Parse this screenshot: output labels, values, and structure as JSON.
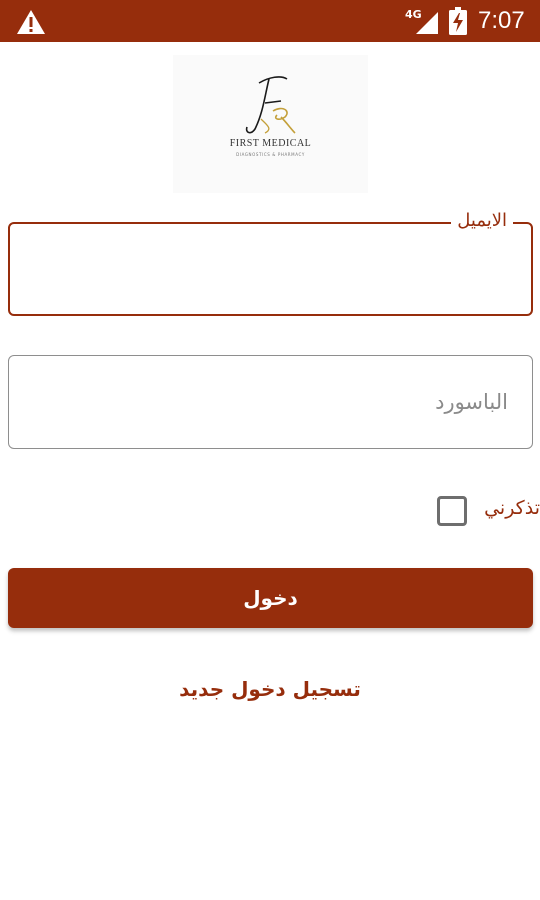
{
  "status_bar": {
    "time": "7:07",
    "network": "4G",
    "icons": [
      "warning-icon",
      "signal-icon",
      "battery-charging-icon"
    ],
    "background_color": "#962d0c"
  },
  "logo": {
    "name": "FIRST MEDICAL",
    "subtitle": "DIAGNOSTICS & PHARMACY"
  },
  "form": {
    "email_label": "الايميل",
    "email_value": "",
    "password_placeholder": "الباسورد",
    "password_value": "",
    "remember_label": "تذكرني",
    "remember_checked": false,
    "login_label": "دخول",
    "register_label": "تسجيل دخول جديد"
  },
  "colors": {
    "accent": "#962d0c",
    "input_border": "#8e8e8e"
  }
}
